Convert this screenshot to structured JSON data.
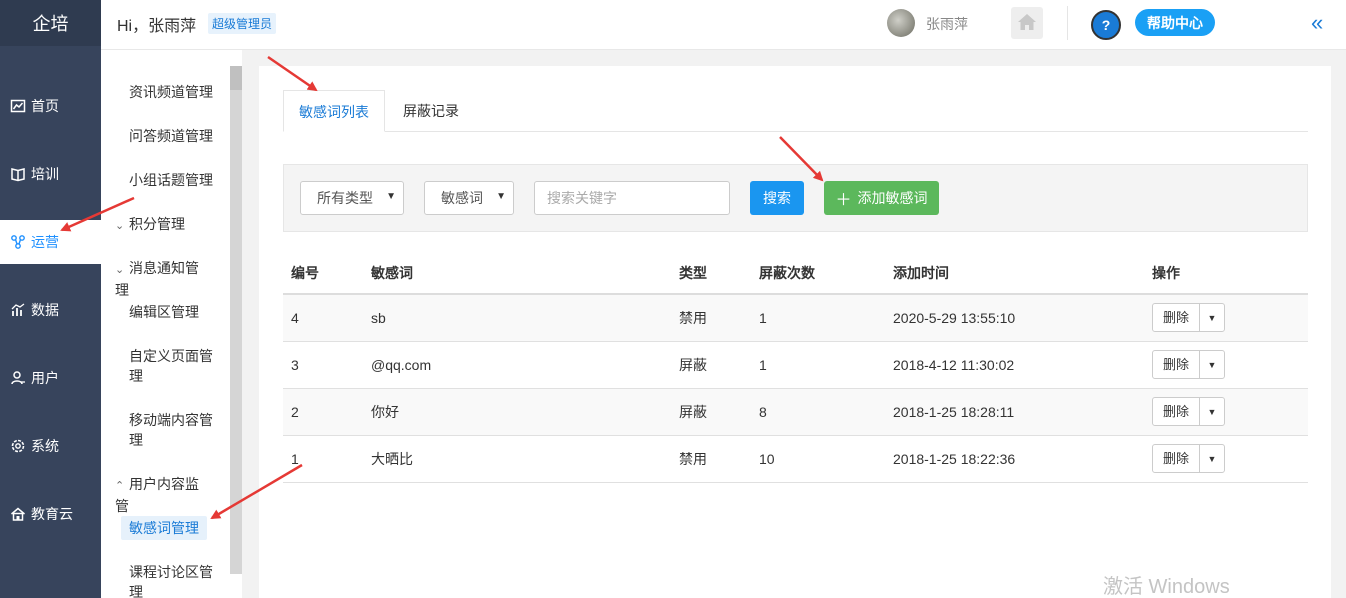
{
  "nav": {
    "brand": "企培",
    "items": [
      {
        "label": "首页",
        "icon": "chart-line-icon"
      },
      {
        "label": "培训",
        "icon": "book-icon"
      },
      {
        "label": "运营",
        "icon": "network-icon",
        "active": true
      },
      {
        "label": "数据",
        "icon": "bar-chart-icon"
      },
      {
        "label": "用户",
        "icon": "user-icon"
      },
      {
        "label": "系统",
        "icon": "gear-icon"
      },
      {
        "label": "教育云",
        "icon": "cloud-home-icon"
      }
    ]
  },
  "subnav": {
    "items": [
      {
        "label": "资讯频道管理"
      },
      {
        "label": "问答频道管理"
      },
      {
        "label": "小组话题管理"
      },
      {
        "label": "积分管理",
        "chevron": "⌄"
      },
      {
        "label": "消息通知管理",
        "chevron": "⌄"
      },
      {
        "label": "编辑区管理"
      },
      {
        "label": "自定义页面管理"
      },
      {
        "label": "移动端内容管理"
      },
      {
        "label": "用户内容监管",
        "chevron": "⌃"
      },
      {
        "label": "敏感词管理",
        "active": true
      },
      {
        "label": "课程讨论区管理"
      }
    ]
  },
  "header": {
    "greeting": "Hi，张雨萍",
    "role_badge": "超级管理员",
    "username": "张雨萍",
    "help_label": "帮助中心",
    "help_icon_text": "?",
    "collapse_glyph": "«"
  },
  "tabs": [
    {
      "label": "敏感词列表",
      "active": true
    },
    {
      "label": "屏蔽记录"
    }
  ],
  "filter": {
    "type_select": "所有类型",
    "field_select": "敏感词",
    "search_placeholder": "搜索关键字",
    "search_button": "搜索",
    "add_button": "添加敏感词"
  },
  "table": {
    "columns": [
      "编号",
      "敏感词",
      "类型",
      "屏蔽次数",
      "添加时间",
      "操作"
    ],
    "rows": [
      {
        "id": "4",
        "word": "sb",
        "type": "禁用",
        "count": "1",
        "time": "2020-5-29 13:55:10"
      },
      {
        "id": "3",
        "word": "@qq.com",
        "type": "屏蔽",
        "count": "1",
        "time": "2018-4-12 11:30:02"
      },
      {
        "id": "2",
        "word": "你好",
        "type": "屏蔽",
        "count": "8",
        "time": "2018-1-25 18:28:11"
      },
      {
        "id": "1",
        "word": "大晒比",
        "type": "禁用",
        "count": "10",
        "time": "2018-1-25 18:22:36"
      }
    ],
    "delete_label": "删除"
  },
  "watermark": "激活 Windows",
  "colors": {
    "nav_bg": "#37445c",
    "accent": "#1a7bd6",
    "add_green": "#5cb85c",
    "annotation_red": "#e53935"
  }
}
